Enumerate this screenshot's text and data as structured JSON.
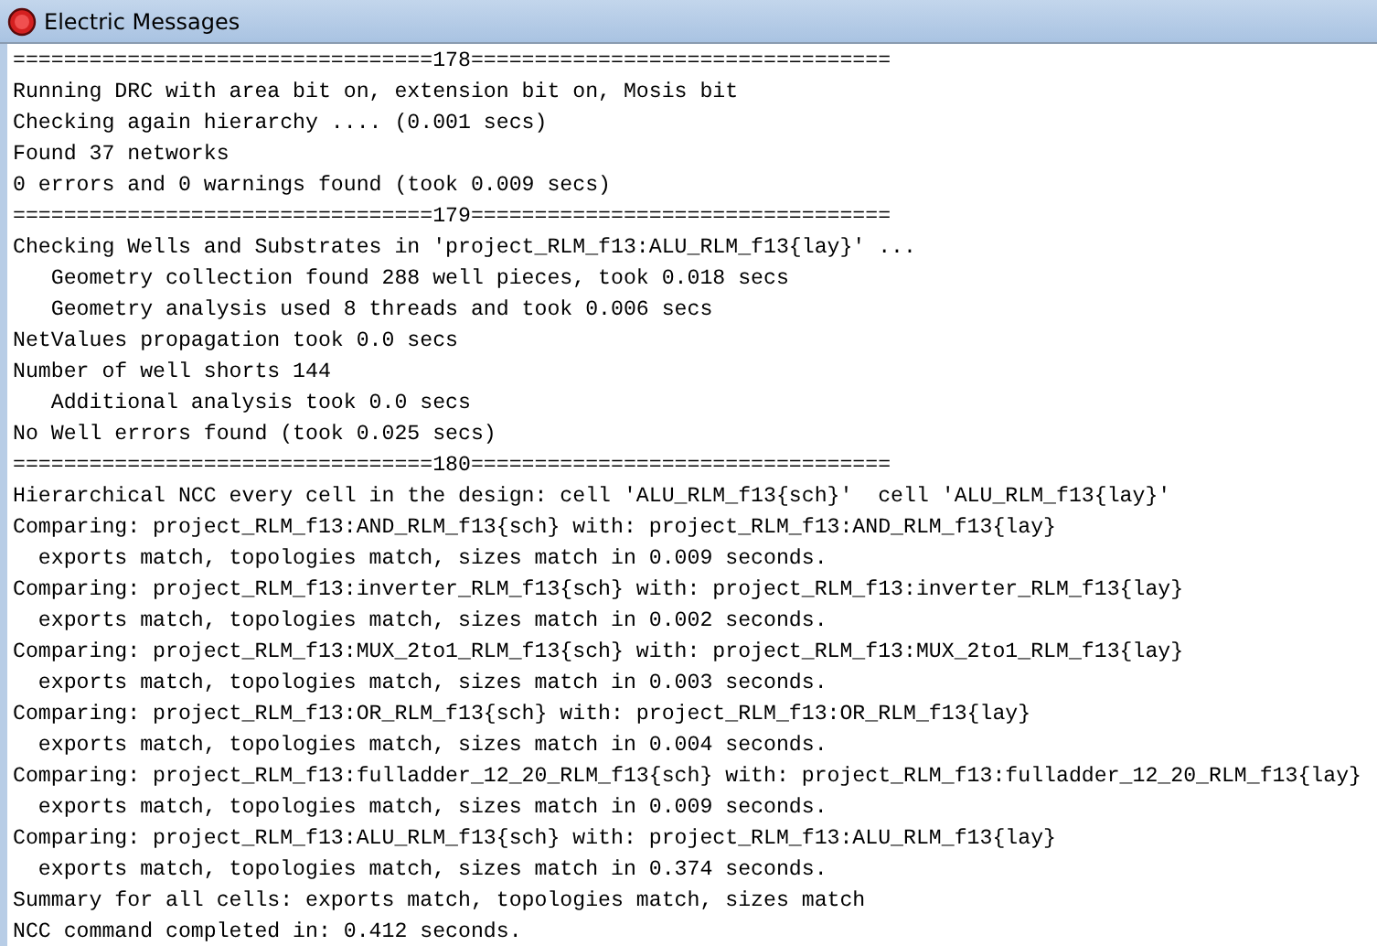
{
  "window": {
    "title": "Electric Messages"
  },
  "lines": [
    "=================================178=================================",
    "Running DRC with area bit on, extension bit on, Mosis bit",
    "Checking again hierarchy .... (0.001 secs)",
    "Found 37 networks",
    "0 errors and 0 warnings found (took 0.009 secs)",
    "=================================179=================================",
    "Checking Wells and Substrates in 'project_RLM_f13:ALU_RLM_f13{lay}' ...",
    "   Geometry collection found 288 well pieces, took 0.018 secs",
    "   Geometry analysis used 8 threads and took 0.006 secs",
    "NetValues propagation took 0.0 secs",
    "Number of well shorts 144",
    "   Additional analysis took 0.0 secs",
    "No Well errors found (took 0.025 secs)",
    "=================================180=================================",
    "Hierarchical NCC every cell in the design: cell 'ALU_RLM_f13{sch}'  cell 'ALU_RLM_f13{lay}'",
    "Comparing: project_RLM_f13:AND_RLM_f13{sch} with: project_RLM_f13:AND_RLM_f13{lay}",
    "  exports match, topologies match, sizes match in 0.009 seconds.",
    "Comparing: project_RLM_f13:inverter_RLM_f13{sch} with: project_RLM_f13:inverter_RLM_f13{lay}",
    "  exports match, topologies match, sizes match in 0.002 seconds.",
    "Comparing: project_RLM_f13:MUX_2to1_RLM_f13{sch} with: project_RLM_f13:MUX_2to1_RLM_f13{lay}",
    "  exports match, topologies match, sizes match in 0.003 seconds.",
    "Comparing: project_RLM_f13:OR_RLM_f13{sch} with: project_RLM_f13:OR_RLM_f13{lay}",
    "  exports match, topologies match, sizes match in 0.004 seconds.",
    "Comparing: project_RLM_f13:fulladder_12_20_RLM_f13{sch} with: project_RLM_f13:fulladder_12_20_RLM_f13{lay}",
    "  exports match, topologies match, sizes match in 0.009 seconds.",
    "Comparing: project_RLM_f13:ALU_RLM_f13{sch} with: project_RLM_f13:ALU_RLM_f13{lay}",
    "  exports match, topologies match, sizes match in 0.374 seconds.",
    "Summary for all cells: exports match, topologies match, sizes match",
    "NCC command completed in: 0.412 seconds."
  ]
}
